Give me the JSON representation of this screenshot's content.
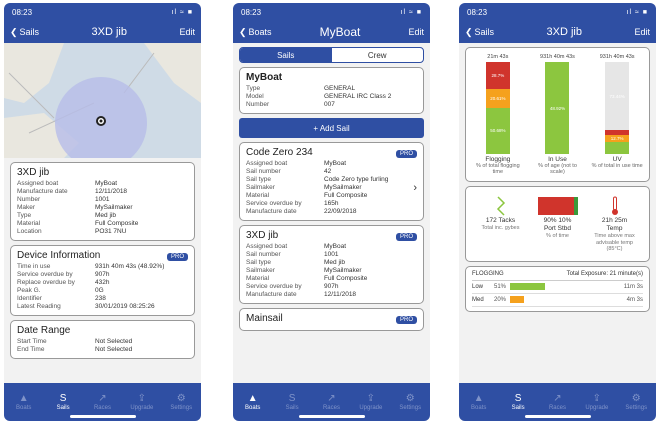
{
  "status": {
    "time": "08:23",
    "signal": "ıl ≈ ■"
  },
  "screen1": {
    "nav": {
      "back": "Sails",
      "title": "3XD jib",
      "edit": "Edit"
    },
    "sail": {
      "name": "3XD jib",
      "rows": [
        {
          "k": "Assigned boat",
          "v": "MyBoat"
        },
        {
          "k": "Manufacture date",
          "v": "12/11/2018"
        },
        {
          "k": "Number",
          "v": "1001"
        },
        {
          "k": "Maker",
          "v": "MySailmaker"
        },
        {
          "k": "Type",
          "v": "Med jib"
        },
        {
          "k": "Material",
          "v": "Full Composite"
        },
        {
          "k": "Location",
          "v": "PO31 7NU"
        }
      ]
    },
    "device": {
      "title": "Device Information",
      "badge": "PRO",
      "rows": [
        {
          "k": "Time in use",
          "v": "931h 40m 43s (48.92%)"
        },
        {
          "k": "Service overdue by",
          "v": "907h"
        },
        {
          "k": "Replace overdue by",
          "v": "432h"
        },
        {
          "k": "Peak G.",
          "v": "0G"
        },
        {
          "k": "Identifier",
          "v": "238"
        },
        {
          "k": "Latest Reading",
          "v": "30/01/2019 08:25:26"
        }
      ]
    },
    "daterange": {
      "title": "Date Range",
      "rows": [
        {
          "k": "Start Time",
          "v": "Not Selected"
        },
        {
          "k": "End Time",
          "v": "Not Selected"
        }
      ]
    }
  },
  "screen2": {
    "nav": {
      "back": "Boats",
      "title": "MyBoat",
      "edit": "Edit"
    },
    "segments": {
      "sails": "Sails",
      "crew": "Crew"
    },
    "boat": {
      "name": "MyBoat",
      "rows": [
        {
          "k": "Type",
          "v": "GENERAL"
        },
        {
          "k": "Model",
          "v": "GENERAL IRC Class 2"
        },
        {
          "k": "Number",
          "v": "007"
        }
      ]
    },
    "add_sail": "+ Add Sail",
    "sail1": {
      "name": "Code Zero 234",
      "badge": "PRO",
      "rows": [
        {
          "k": "Assigned boat",
          "v": "MyBoat"
        },
        {
          "k": "Sail number",
          "v": "42"
        },
        {
          "k": "Sail type",
          "v": "Code Zero type furling"
        },
        {
          "k": "Sailmaker",
          "v": "MySailmaker"
        },
        {
          "k": "Material",
          "v": "Full Composite"
        },
        {
          "k": "Service overdue by",
          "v": "165h"
        },
        {
          "k": "Manufacture date",
          "v": "22/09/2018"
        }
      ]
    },
    "sail2": {
      "name": "3XD jib",
      "badge": "PRO",
      "rows": [
        {
          "k": "Assigned boat",
          "v": "MyBoat"
        },
        {
          "k": "Sail number",
          "v": "1001"
        },
        {
          "k": "Sail type",
          "v": "Med jib"
        },
        {
          "k": "Sailmaker",
          "v": "MySailmaker"
        },
        {
          "k": "Material",
          "v": "Full Composite"
        },
        {
          "k": "Service overdue by",
          "v": "907h"
        },
        {
          "k": "Manufacture date",
          "v": "12/11/2018"
        }
      ]
    },
    "sail3": {
      "name": "Mainsail",
      "badge": "PRO"
    }
  },
  "screen3": {
    "nav": {
      "back": "Sails",
      "title": "3XD jib",
      "edit": "Edit"
    },
    "bars": [
      {
        "cap": "21m 43s",
        "lbl": "Flogging",
        "sub": "% of total flogging time",
        "segments": [
          {
            "pct": 29,
            "color": "#d0342c",
            "text": "28.7%"
          },
          {
            "pct": 21,
            "color": "#f5a11d",
            "text": "20.61%"
          },
          {
            "pct": 50,
            "color": "#8cc63f",
            "text": "50.68%"
          }
        ]
      },
      {
        "cap": "931h 40m 43s",
        "lbl": "In Use",
        "sub": "% of age (not to scale)",
        "segments": [
          {
            "pct": 100,
            "color": "#8cc63f",
            "text": "48.92%"
          }
        ]
      },
      {
        "cap": "931h 40m 43s",
        "lbl": "UV",
        "sub": "% of total in use time",
        "segments": [
          {
            "pct": 74,
            "color": "#e6e6e6",
            "text": "73.44%"
          },
          {
            "pct": 5,
            "color": "#d0342c",
            "text": ""
          },
          {
            "pct": 8,
            "color": "#f5a11d",
            "text": "12.7%"
          },
          {
            "pct": 13,
            "color": "#8cc63f",
            "text": ""
          }
        ]
      }
    ],
    "stats": [
      {
        "big": "172 Tacks",
        "small": "Total inc. gybes"
      },
      {
        "big": "90%  10%",
        "big2": "Port  Stbd",
        "small": "% of time"
      },
      {
        "big": "21h 25m",
        "big2": "Temp",
        "small": "Time above max advisable temp (85°C)"
      }
    ],
    "flogging": {
      "title": "FLOGGING",
      "exposure": "Total Exposure: 21 minute(s)",
      "rows": [
        {
          "name": "Low",
          "pct": "51%",
          "time": "11m 3s",
          "color": "#8cc63f",
          "fill": 51
        },
        {
          "name": "Med",
          "pct": "20%",
          "time": "4m 3s",
          "color": "#f5a11d",
          "fill": 20
        }
      ]
    }
  },
  "tabs": [
    "Boats",
    "Sails",
    "Races",
    "Upgrade",
    "Settings"
  ],
  "tabs_icons": [
    "▲",
    "S",
    "↗",
    "⇪",
    "⚙"
  ]
}
